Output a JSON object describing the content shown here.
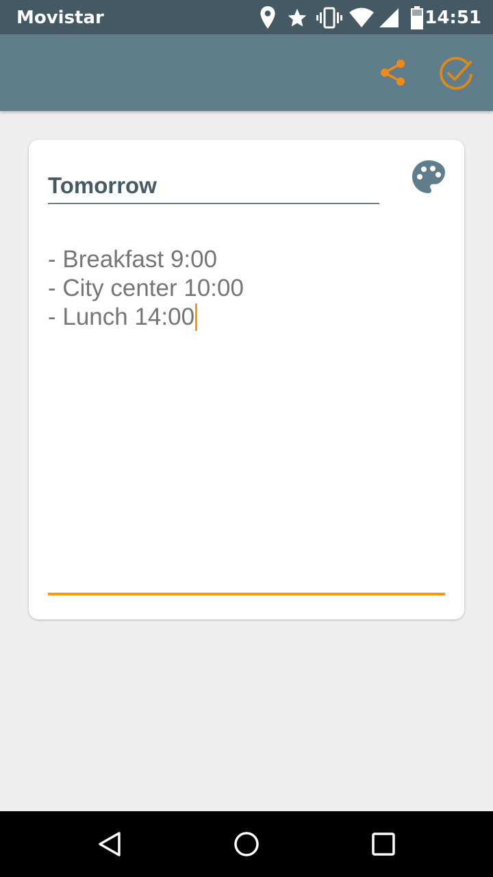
{
  "status_bar": {
    "carrier": "Movistar",
    "time": "14:51",
    "icons": [
      "location-icon",
      "star-icon",
      "vibrate-icon",
      "wifi-icon",
      "signal-icon",
      "battery-icon"
    ]
  },
  "app_bar": {
    "actions": [
      "share-icon",
      "check-circle-icon"
    ],
    "accent_color": "#ef8a17",
    "background": "#607d8b"
  },
  "note": {
    "title": "Tomorrow",
    "body_lines": [
      "- Breakfast 9:00",
      "- City center 10:00",
      "- Lunch 14:00"
    ],
    "palette_icon": "palette-icon",
    "accent_color": "#ff9800"
  },
  "nav_bar": {
    "buttons": [
      "back-icon",
      "home-icon",
      "recents-icon"
    ]
  }
}
